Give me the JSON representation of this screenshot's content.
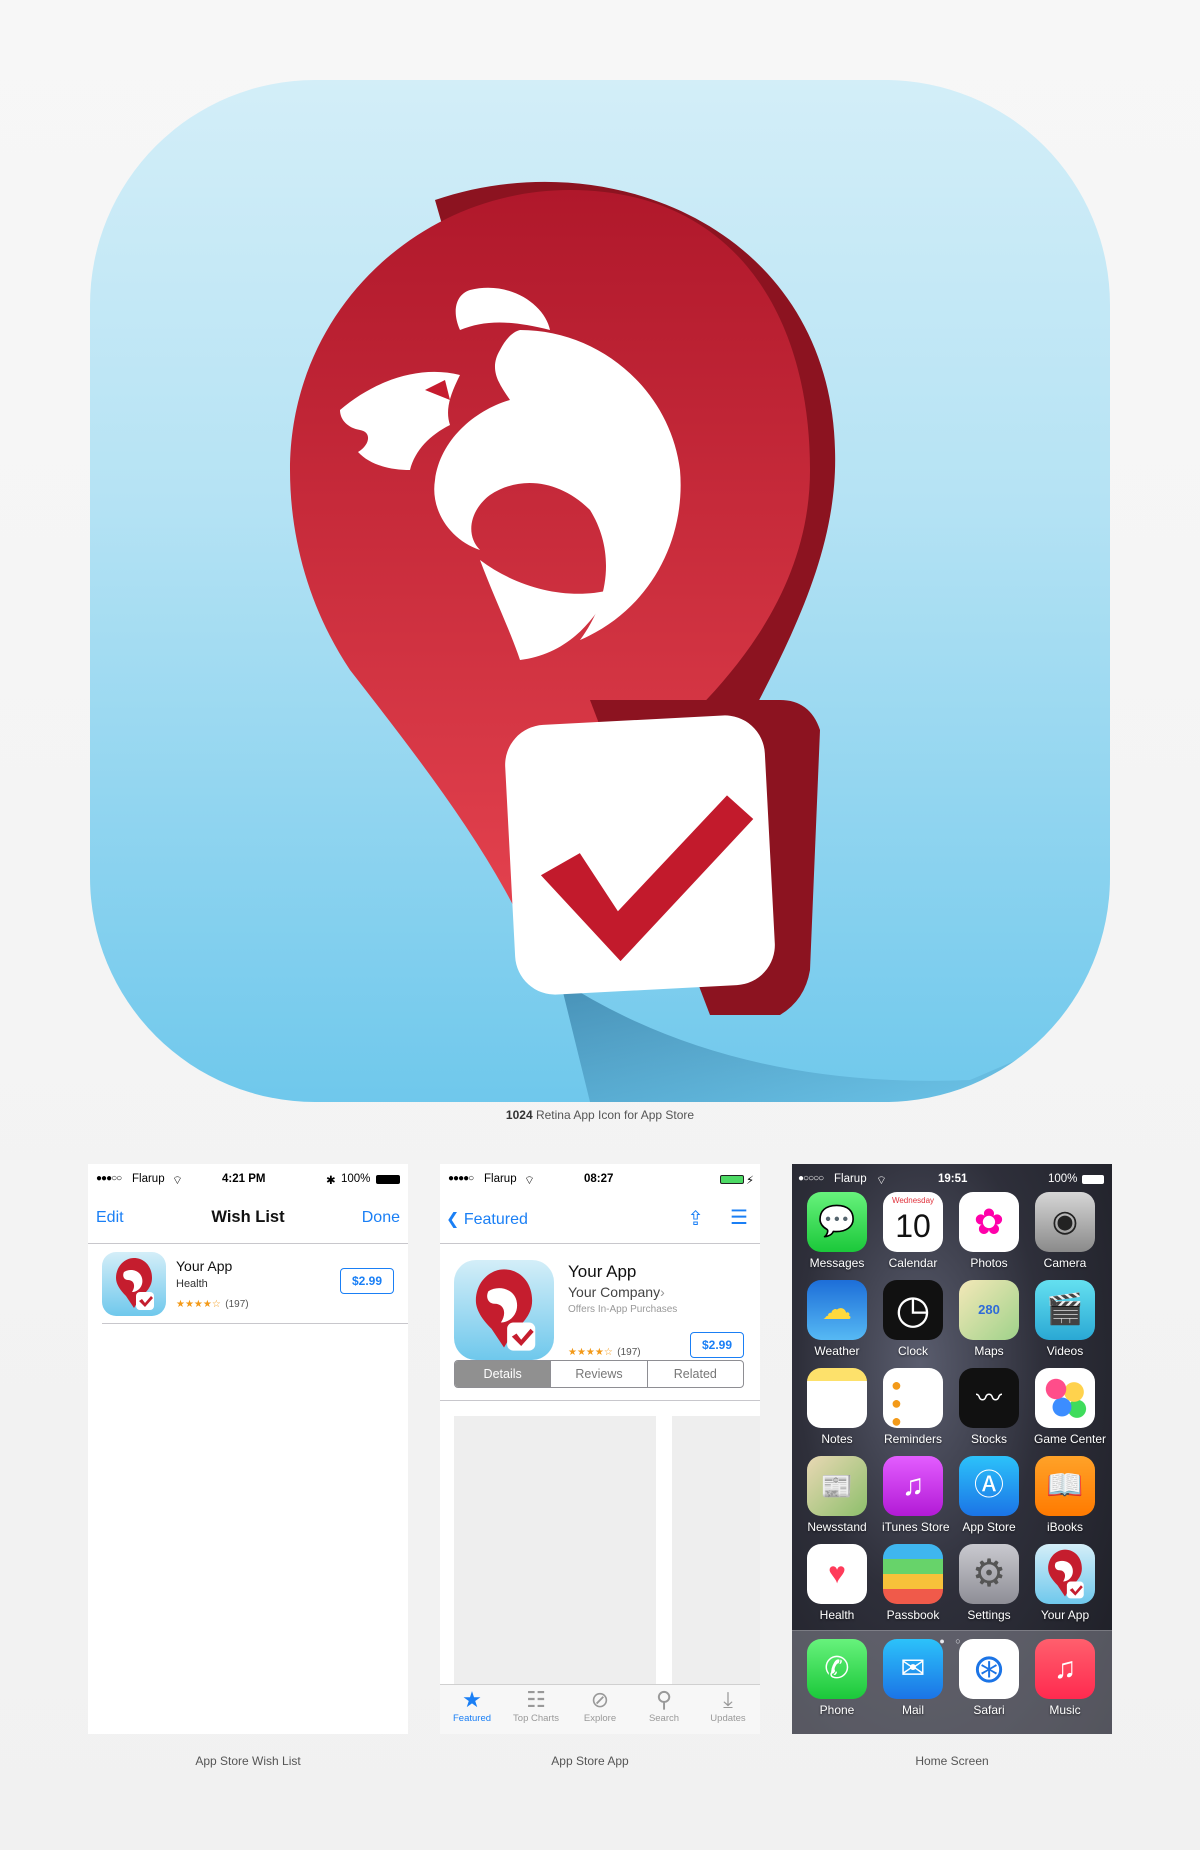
{
  "main_icon": {
    "caption_bold": "1024",
    "caption_rest": " Retina App Icon for App Store"
  },
  "wishlist": {
    "caption": "App Store Wish List",
    "status": {
      "carrier": "Flarup",
      "time": "4:21 PM",
      "battery": "100%"
    },
    "nav": {
      "left": "Edit",
      "title": "Wish List",
      "right": "Done"
    },
    "item": {
      "name": "Your App",
      "category": "Health",
      "stars": "★★★★☆",
      "count": "(197)",
      "price": "$2.99"
    }
  },
  "appstore": {
    "caption": "App Store App",
    "status": {
      "carrier": "Flarup",
      "time": "08:27"
    },
    "nav": {
      "back": "Featured"
    },
    "app": {
      "name": "Your App",
      "company": "Your Company",
      "note": "Offers In-App Purchases",
      "stars": "★★★★☆",
      "count": "(197)",
      "price": "$2.99"
    },
    "segments": [
      "Details",
      "Reviews",
      "Related"
    ],
    "tabs": [
      {
        "label": "Featured",
        "icon": "star-icon"
      },
      {
        "label": "Top Charts",
        "icon": "list-icon"
      },
      {
        "label": "Explore",
        "icon": "compass-icon"
      },
      {
        "label": "Search",
        "icon": "search-icon"
      },
      {
        "label": "Updates",
        "icon": "download-icon"
      }
    ]
  },
  "homescreen": {
    "caption": "Home Screen",
    "status": {
      "carrier": "Flarup",
      "time": "19:51",
      "battery": "100%"
    },
    "calendar": {
      "day": "Wednesday",
      "date": "10"
    },
    "apps": [
      "Messages",
      "Calendar",
      "Photos",
      "Camera",
      "Weather",
      "Clock",
      "Maps",
      "Videos",
      "Notes",
      "Reminders",
      "Stocks",
      "Game Center",
      "Newsstand",
      "iTunes Store",
      "App Store",
      "iBooks",
      "Health",
      "Passbook",
      "Settings",
      "Your App"
    ],
    "dock": [
      "Phone",
      "Mail",
      "Safari",
      "Music"
    ]
  }
}
